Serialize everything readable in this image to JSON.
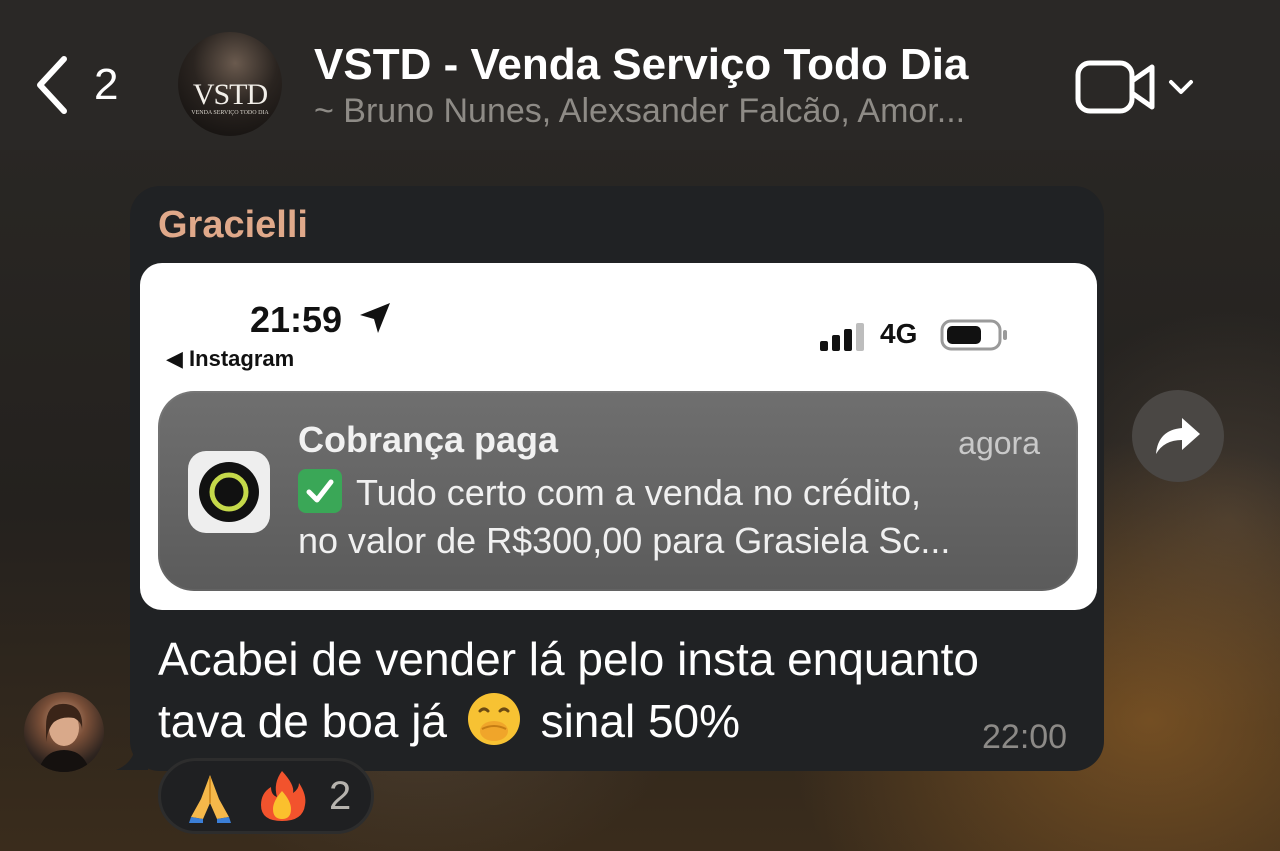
{
  "header": {
    "back_count": "2",
    "avatar_logo": "VSTD",
    "avatar_subtitle": "VENDA SERVIÇO TODO DIA",
    "title": "VSTD - Venda Serviço Todo Dia",
    "members": "~ Bruno Nunes, Alexsander Falcão, Amor..."
  },
  "message": {
    "sender": "Gracielli",
    "text_line1": "Acabei de vender lá pelo insta enquanto",
    "text_line2_a": "tava de boa já",
    "text_line2_b": "sinal 50%",
    "time": "22:00",
    "reactions": {
      "emojis": [
        "folded-hands",
        "fire"
      ],
      "count": "2"
    }
  },
  "screenshot": {
    "status_time": "21:59",
    "back_app": "Instagram",
    "network": "4G",
    "notification": {
      "title": "Cobrança paga",
      "time": "agora",
      "body_line1": "Tudo certo com a venda no crédito,",
      "body_line2": "no valor de R$300,00 para Grasiela Sc..."
    }
  },
  "colors": {
    "sender_name": "#e0a98a",
    "bubble": "#202224",
    "header": "#2a2826"
  }
}
